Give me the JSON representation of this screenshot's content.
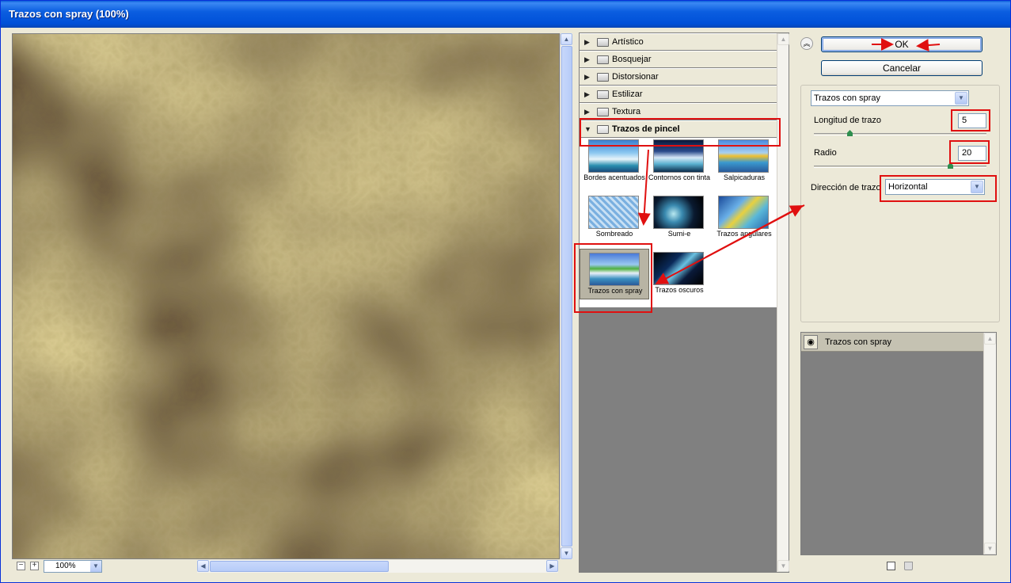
{
  "window": {
    "title": "Trazos con spray (100%)"
  },
  "preview": {
    "zoom": "100%"
  },
  "gallery": {
    "categories": [
      {
        "label": "Artístico",
        "expanded": false
      },
      {
        "label": "Bosquejar",
        "expanded": false
      },
      {
        "label": "Distorsionar",
        "expanded": false
      },
      {
        "label": "Estilizar",
        "expanded": false
      },
      {
        "label": "Textura",
        "expanded": false
      },
      {
        "label": "Trazos de pincel",
        "expanded": true
      }
    ],
    "filters": [
      "Bordes acentuados",
      "Contornos con tinta",
      "Salpicaduras",
      "Sombreado",
      "Sumi-e",
      "Trazos angulares",
      "Trazos con spray",
      "Trazos oscuros"
    ],
    "selected_filter": "Trazos con spray"
  },
  "buttons": {
    "ok": "OK",
    "cancel": "Cancelar"
  },
  "settings": {
    "filter_select": "Trazos con spray",
    "longitud_label": "Longitud de trazo",
    "longitud_value": "5",
    "longitud_level": 0.2,
    "radio_label": "Radio",
    "radio_value": "20",
    "radio_level": 0.8,
    "direccion_label": "Dirección de trazo",
    "direccion_value": "Horizontal"
  },
  "layers": {
    "active": "Trazos con spray"
  },
  "icons": [
    "collapse-icon",
    "eye-icon",
    "new-effect-layer-icon",
    "trash-icon",
    "folder-icon",
    "triangle-right-icon",
    "triangle-down-icon",
    "chevron-down-icon",
    "zoom-out-icon",
    "zoom-in-icon"
  ],
  "colors": {
    "annotation": "#e01010",
    "title_bar": "#0050d8",
    "texture": "#8a7a3a"
  }
}
